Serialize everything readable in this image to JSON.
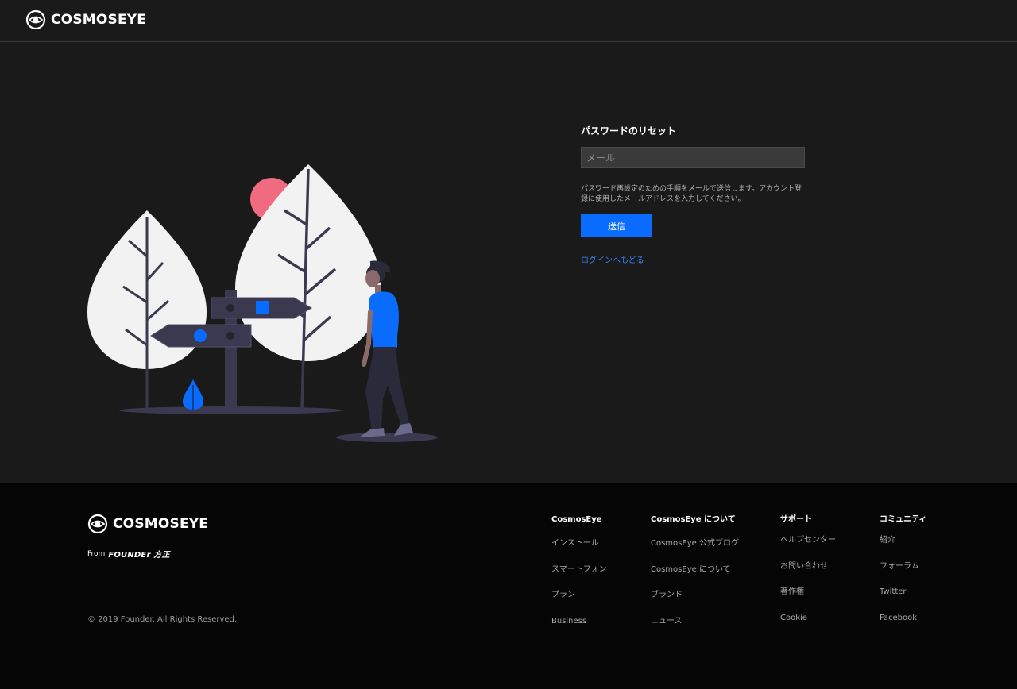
{
  "brand": {
    "name": "COSMOSEYE",
    "logo_icon": "cosmoseye-eye-icon"
  },
  "form": {
    "title": "パスワードのリセット",
    "email_placeholder": "メール",
    "email_value": "",
    "hint": "パスワード再設定のための手順をメールで送信します。アカウント登録に使用したメールアドレスを入力してください。",
    "submit_label": "送信",
    "back_link": "ログインへもどる"
  },
  "colors": {
    "accent": "#0a6bff",
    "link": "#3b82f6",
    "background": "#1a1a1a",
    "footer": "#050505",
    "sun": "#f06a80"
  },
  "footer": {
    "from_label": "From",
    "from_brand": "FOUNDEr 方正",
    "copyright": "© 2019 Founder. All Rights Reserved.",
    "columns": [
      {
        "title": "CosmosEye",
        "items": [
          "インストール",
          "スマートフォン",
          "プラン",
          "Business"
        ]
      },
      {
        "title": "CosmosEye について",
        "items": [
          "CosmosEye 公式ブログ",
          "CosmosEye について",
          "ブランド",
          "ニュース"
        ]
      },
      {
        "title": "サポート",
        "items": [
          "ヘルプセンター",
          "お問い合わせ",
          "著作権",
          "Cookie"
        ]
      },
      {
        "title": "コミュニティ",
        "items": [
          "紹介",
          "フォーラム",
          "Twitter",
          "Facebook"
        ]
      }
    ]
  }
}
